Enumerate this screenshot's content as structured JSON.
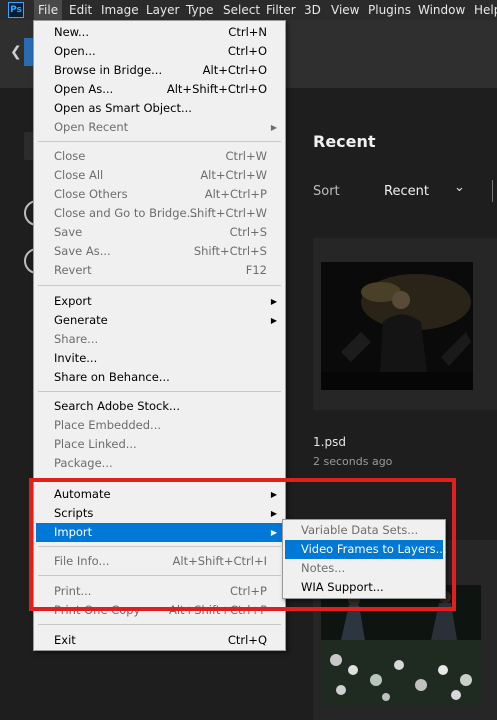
{
  "app": {
    "logo_text": "Ps"
  },
  "menubar": {
    "items": [
      "File",
      "Edit",
      "Image",
      "Layer",
      "Type",
      "Select",
      "Filter",
      "3D",
      "View",
      "Plugins",
      "Window",
      "Help"
    ],
    "active": "File"
  },
  "home": {
    "recent_title": "Recent",
    "sort_label": "Sort",
    "sort_value": "Recent",
    "files": [
      {
        "name": "1.psd",
        "time": "2 seconds ago"
      }
    ]
  },
  "file_menu": {
    "new": {
      "label": "New...",
      "shortcut": "Ctrl+N"
    },
    "open": {
      "label": "Open...",
      "shortcut": "Ctrl+O"
    },
    "browse_bridge": {
      "label": "Browse in Bridge...",
      "shortcut": "Alt+Ctrl+O"
    },
    "open_as": {
      "label": "Open As...",
      "shortcut": "Alt+Shift+Ctrl+O"
    },
    "open_smart": {
      "label": "Open as Smart Object..."
    },
    "open_recent": {
      "label": "Open Recent"
    },
    "close": {
      "label": "Close",
      "shortcut": "Ctrl+W"
    },
    "close_all": {
      "label": "Close All",
      "shortcut": "Alt+Ctrl+W"
    },
    "close_others": {
      "label": "Close Others",
      "shortcut": "Alt+Ctrl+P"
    },
    "close_bridge": {
      "label": "Close and Go to Bridge...",
      "shortcut": "Shift+Ctrl+W"
    },
    "save": {
      "label": "Save",
      "shortcut": "Ctrl+S"
    },
    "save_as": {
      "label": "Save As...",
      "shortcut": "Shift+Ctrl+S"
    },
    "revert": {
      "label": "Revert",
      "shortcut": "F12"
    },
    "export": {
      "label": "Export"
    },
    "generate": {
      "label": "Generate"
    },
    "share": {
      "label": "Share..."
    },
    "invite": {
      "label": "Invite..."
    },
    "behance": {
      "label": "Share on Behance..."
    },
    "search_stock": {
      "label": "Search Adobe Stock..."
    },
    "place_embedded": {
      "label": "Place Embedded..."
    },
    "place_linked": {
      "label": "Place Linked..."
    },
    "package": {
      "label": "Package..."
    },
    "automate": {
      "label": "Automate"
    },
    "scripts": {
      "label": "Scripts"
    },
    "import": {
      "label": "Import"
    },
    "file_info": {
      "label": "File Info...",
      "shortcut": "Alt+Shift+Ctrl+I"
    },
    "print": {
      "label": "Print...",
      "shortcut": "Ctrl+P"
    },
    "print_one": {
      "label": "Print One Copy",
      "shortcut": "Alt+Shift+Ctrl+P"
    },
    "exit": {
      "label": "Exit",
      "shortcut": "Ctrl+Q"
    }
  },
  "import_submenu": {
    "variable_data": "Variable Data Sets...",
    "video_frames": "Video Frames to Layers...",
    "notes": "Notes...",
    "wia": "WIA Support..."
  },
  "colors": {
    "highlight": "#0078d7",
    "annotation_box": "#e02020"
  }
}
